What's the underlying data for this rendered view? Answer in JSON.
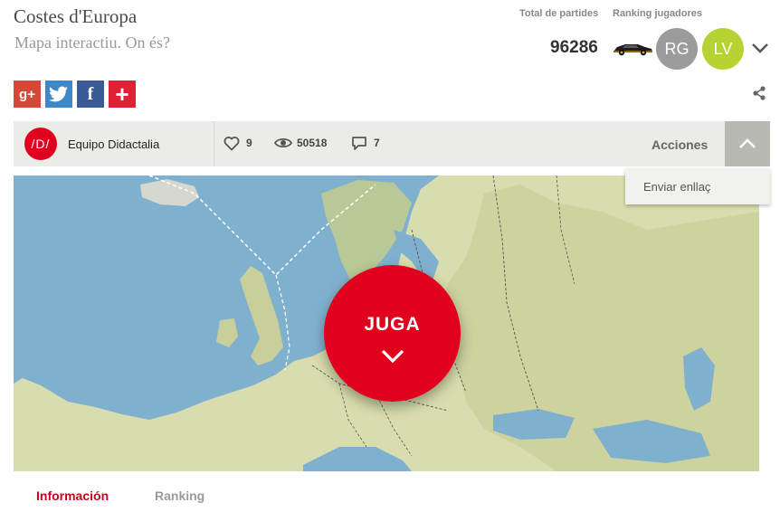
{
  "header": {
    "title": "Costes d'Europa",
    "subtitle": "Mapa interactiu. On és?"
  },
  "stats": {
    "total_label": "Total de partides",
    "total_value": "96286",
    "ranking_label": "Ranking jugadores",
    "players": [
      {
        "initials": "RG",
        "color": "#9b9b9b"
      },
      {
        "initials": "LV",
        "color": "#b6d233"
      }
    ]
  },
  "social": {
    "google": "g+",
    "facebook": "f",
    "more": "+"
  },
  "info_bar": {
    "author_logo": "/D/",
    "author": "Equipo Didactalia",
    "likes": "9",
    "views": "50518",
    "comments": "7",
    "actions_label": "Acciones"
  },
  "dropdown": {
    "items": [
      "Enviar enllaç"
    ]
  },
  "map": {
    "play_label": "JUGA"
  },
  "tabs": [
    "Información",
    "Ranking"
  ],
  "colors": {
    "accent": "#e2001f",
    "tab_active": "#c7001b",
    "sea": "#7fb1cf",
    "land": "#d9dcae"
  }
}
